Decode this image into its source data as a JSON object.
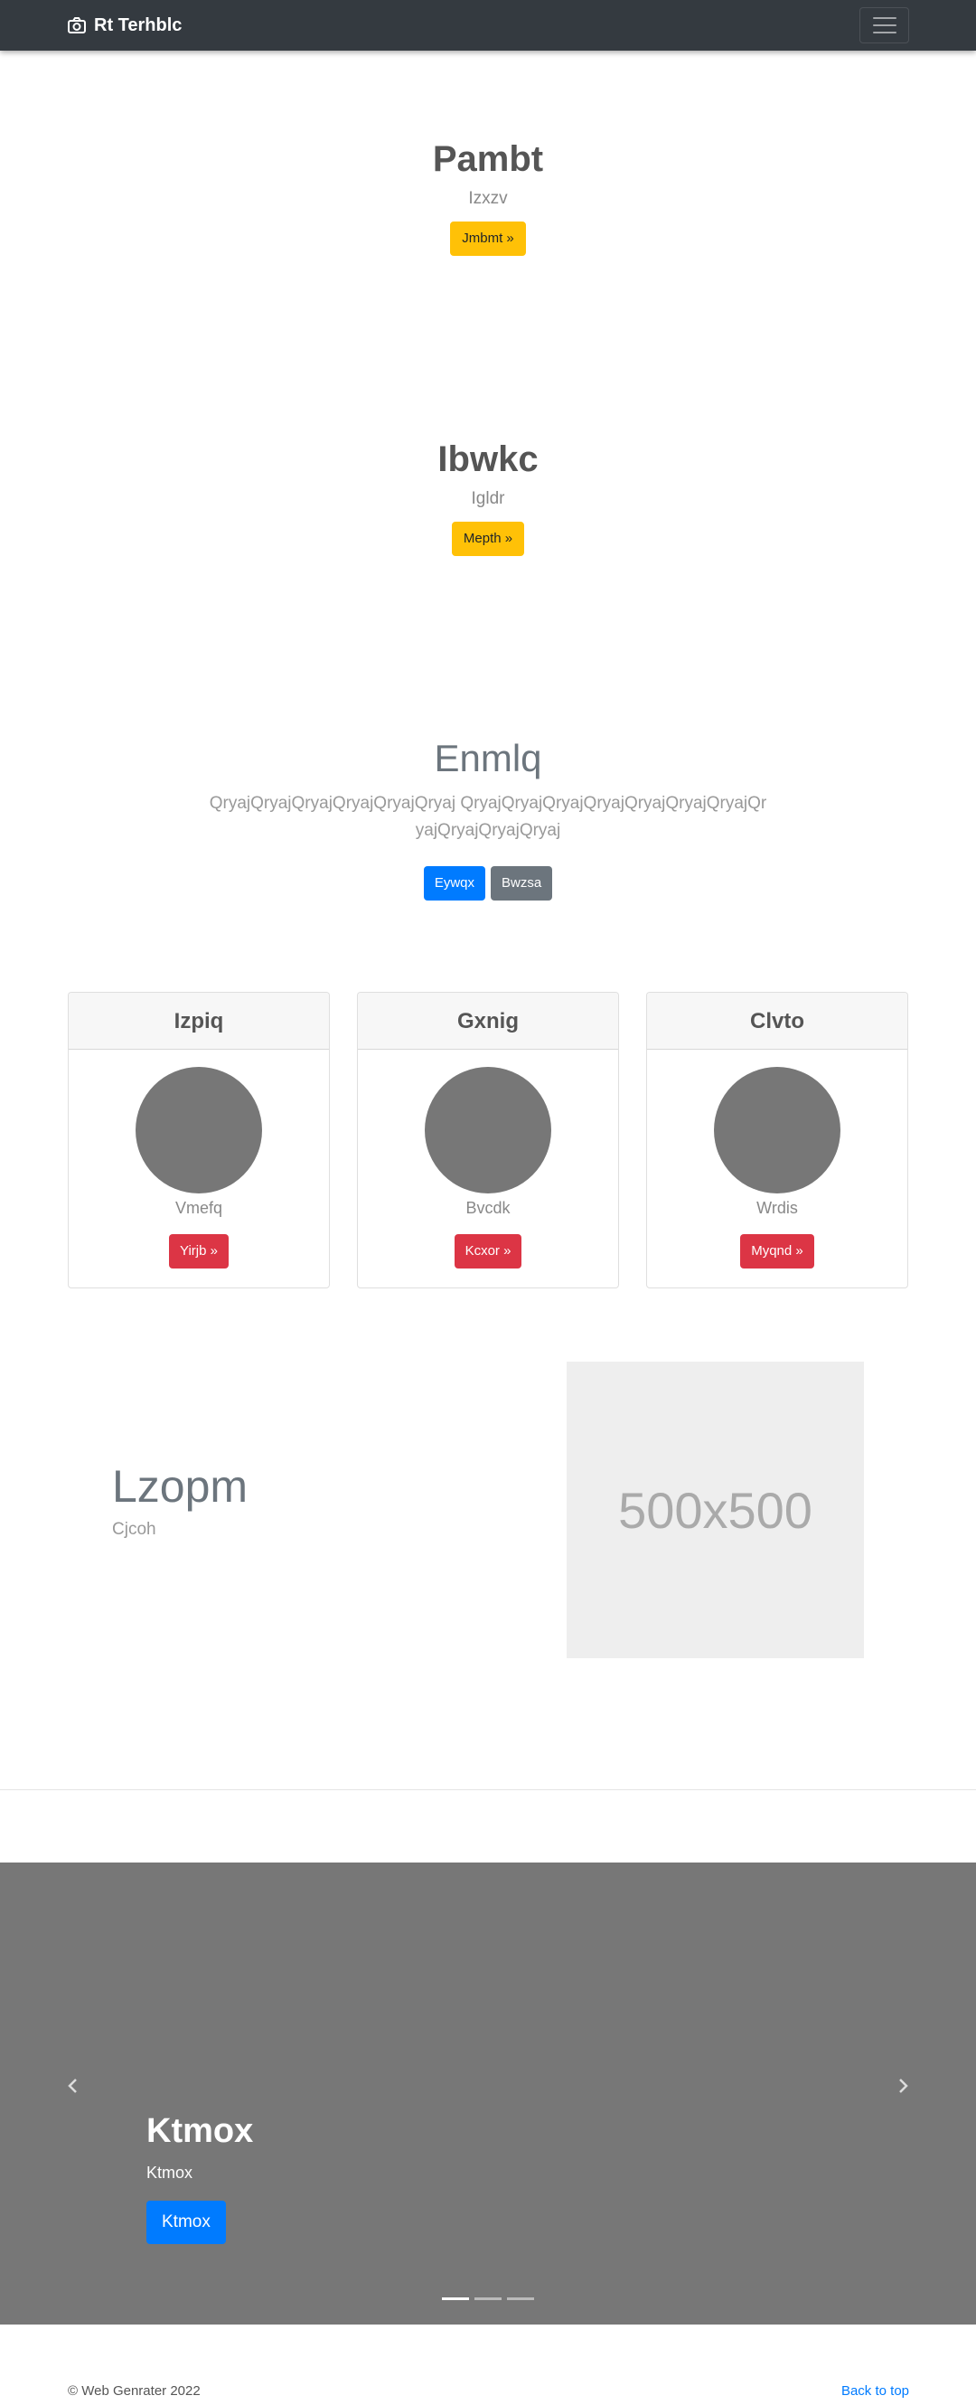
{
  "navbar": {
    "brand": "Rt Terhblc",
    "brand_icon": "camera-icon",
    "toggler_icon": "hamburger-icon"
  },
  "hero1": {
    "title": "Pambt",
    "subtitle": "Izxzv",
    "button": "Jmbmt »"
  },
  "hero2": {
    "title": "Ibwkc",
    "subtitle": "Igldr",
    "button": "Mepth »"
  },
  "jumbotron": {
    "title": "Enmlq",
    "lead": "QryajQryajQryajQryajQryajQryaj QryajQryajQryajQryajQryajQryajQryajQryajQryajQryajQryaj",
    "primary_button": "Eywqx",
    "secondary_button": "Bwzsa"
  },
  "cards": [
    {
      "header": "Izpiq",
      "text": "Vmefq",
      "button": "Yirjb »"
    },
    {
      "header": "Gxnig",
      "text": "Bvcdk",
      "button": "Kcxor »"
    },
    {
      "header": "Clvto",
      "text": "Wrdis",
      "button": "Myqnd »"
    }
  ],
  "featurette": {
    "title": "Lzopm",
    "subtitle": "Cjcoh",
    "placeholder": "500x500"
  },
  "carousel": {
    "title": "Ktmox",
    "text": "Ktmox",
    "button": "Ktmox",
    "prev_icon": "chevron-left-icon",
    "next_icon": "chevron-right-icon",
    "indicator_count": 3,
    "active_index": 0
  },
  "footer": {
    "copyright": "© Web Genrater 2022",
    "back_to_top": "Back to top"
  },
  "colors": {
    "navbar_bg": "#343a40",
    "warning": "#ffc107",
    "primary": "#007bff",
    "secondary": "#6c757d",
    "danger": "#dc3545",
    "carousel_bg": "#777777"
  }
}
